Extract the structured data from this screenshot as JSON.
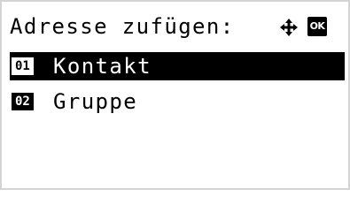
{
  "header": {
    "title": "Adresse zufügen:",
    "nav_icon": "four-way-arrow-icon",
    "ok_label": "OK"
  },
  "menu": {
    "items": [
      {
        "number": "01",
        "label": "Kontakt",
        "selected": true
      },
      {
        "number": "02",
        "label": "Gruppe",
        "selected": false
      }
    ]
  },
  "colors": {
    "background": "#ffffff",
    "foreground": "#000000",
    "highlight": "#000000"
  }
}
